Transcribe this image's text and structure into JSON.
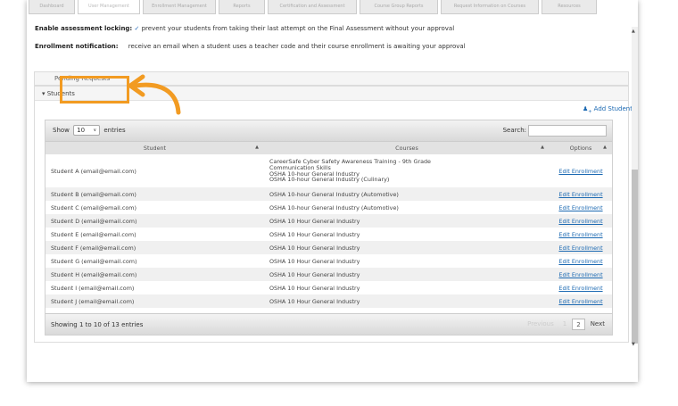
{
  "tabs": [
    "Dashboard",
    "User Management",
    "Enrollment Management",
    "Reports",
    "Certification and Assessment",
    "Course Group Reports",
    "Request Information on Courses",
    "Resources"
  ],
  "settings": {
    "locking_label": "Enable assessment locking:",
    "locking_check": "✓",
    "locking_text": "prevent your students from taking their last attempt on the Final Assessment without your approval",
    "notif_label": "Enrollment notification:",
    "notif_text": "receive an email when a student uses a teacher code and their course enrollment is awaiting your approval"
  },
  "accordion": {
    "requests_label": "Pending Requests",
    "students_label": "▾ Students"
  },
  "add_student": "Add Student",
  "table": {
    "show_label": "Show",
    "entries_value": "10",
    "entries_label": "entries",
    "search_label": "Search:",
    "headers": [
      "Student",
      "Courses",
      "Options"
    ],
    "rows": [
      {
        "student": "Student A (email@email.com)",
        "courses": [
          "CareerSafe Cyber Safety Awareness Training - 9th Grade",
          "Communication Skills",
          "OSHA 10-hour General Industry",
          "OSHA 10-hour General Industry (Culinary)"
        ],
        "option": "Edit Enrollment"
      },
      {
        "student": "Student B (email@email.com)",
        "courses": [
          "OSHA 10-hour General Industry (Automotive)"
        ],
        "option": "Edit Enrollment"
      },
      {
        "student": "Student C (email@email.com)",
        "courses": [
          "OSHA 10-hour General Industry (Automotive)"
        ],
        "option": "Edit Enrollment"
      },
      {
        "student": "Student D (email@email.com)",
        "courses": [
          "OSHA 10 Hour General Industry"
        ],
        "option": "Edit Enrollment"
      },
      {
        "student": "Student E (email@email.com)",
        "courses": [
          "OSHA 10 Hour General Industry"
        ],
        "option": "Edit Enrollment"
      },
      {
        "student": "Student F (email@email.com)",
        "courses": [
          "OSHA 10 Hour General Industry"
        ],
        "option": "Edit Enrollment"
      },
      {
        "student": "Student G (email@email.com)",
        "courses": [
          "OSHA 10 Hour General Industry"
        ],
        "option": "Edit Enrollment"
      },
      {
        "student": "Student H (email@email.com)",
        "courses": [
          "OSHA 10 Hour General Industry"
        ],
        "option": "Edit Enrollment"
      },
      {
        "student": "Student I (email@email.com)",
        "courses": [
          "OSHA 10 Hour General Industry"
        ],
        "option": "Edit Enrollment"
      },
      {
        "student": "Student J (email@email.com)",
        "courses": [
          "OSHA 10 Hour General Industry"
        ],
        "option": "Edit Enrollment"
      }
    ],
    "footer_info": "Showing 1 to 10 of 13 entries",
    "pager": {
      "previous": "Previous",
      "page1": "1",
      "page2": "2",
      "next": "Next"
    }
  },
  "colors": {
    "highlight": "#f29b22",
    "link": "#1b69b2"
  }
}
